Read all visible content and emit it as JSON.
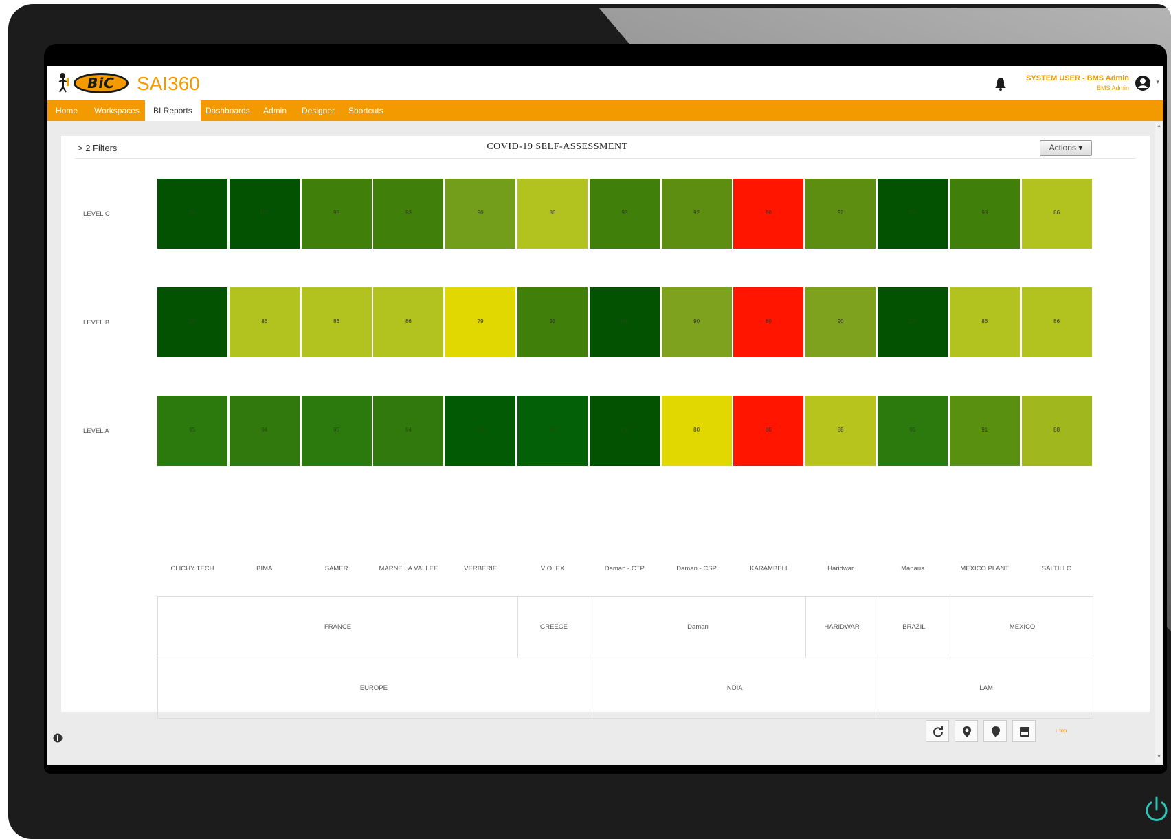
{
  "app": {
    "title": "SAI360",
    "logo_text": "BiC"
  },
  "user": {
    "name": "SYSTEM USER - BMS Admin",
    "role": "BMS Admin"
  },
  "nav": {
    "items": [
      {
        "label": "Home",
        "active": false
      },
      {
        "label": "Workspaces",
        "active": false
      },
      {
        "label": "BI Reports",
        "active": true
      },
      {
        "label": "Dashboards",
        "active": false
      },
      {
        "label": "Admin",
        "active": false
      },
      {
        "label": "Designer",
        "active": false
      },
      {
        "label": "Shortcuts",
        "active": false
      }
    ]
  },
  "report": {
    "filters_label": "> 2 Filters",
    "title": "COVID-19 SELF-ASSESSMENT",
    "actions_label": "Actions ▾"
  },
  "chart_data": {
    "type": "heatmap",
    "title": "COVID-19 SELF-ASSESSMENT",
    "rows": [
      "LEVEL C",
      "LEVEL B",
      "LEVEL A"
    ],
    "columns": [
      "CLICHY TECH",
      "BIMA",
      "SAMER",
      "MARNE LA VALLEE",
      "VERBERIE",
      "VIOLEX",
      "Daman - CTP",
      "Daman - CSP",
      "KARAMBELI",
      "Haridwar",
      "Manaus",
      "MEXICO PLANT",
      "SALTILLO"
    ],
    "values": [
      [
        100,
        100,
        93,
        93,
        90,
        86,
        93,
        92,
        80,
        92,
        100,
        93,
        86
      ],
      [
        100,
        86,
        86,
        86,
        79,
        93,
        100,
        90,
        80,
        90,
        100,
        86,
        86
      ],
      [
        95,
        94,
        95,
        94,
        100,
        98,
        100,
        80,
        80,
        88,
        95,
        91,
        88
      ]
    ],
    "colors": [
      [
        "#025202",
        "#025202",
        "#3f7f0a",
        "#3f7f0a",
        "#739e1b",
        "#b2c21e",
        "#3f7f0a",
        "#5d8e12",
        "#ff1500",
        "#5d8e12",
        "#025202",
        "#3f7f0a",
        "#b2c21e"
      ],
      [
        "#025202",
        "#b2c21e",
        "#b2c21e",
        "#b2c21e",
        "#e0d800",
        "#3f7f0a",
        "#025202",
        "#7ea21d",
        "#ff1500",
        "#7ea21d",
        "#025202",
        "#b2c21e",
        "#b2c21e"
      ],
      [
        "#2c7a0e",
        "#31790d",
        "#2c7a0e",
        "#31790d",
        "#035a04",
        "#046006",
        "#025202",
        "#e0d800",
        "#ff1500",
        "#b7c41e",
        "#2c7a0e",
        "#5a900f",
        "#a0b81e"
      ]
    ],
    "country_groups": [
      {
        "name": "FRANCE",
        "span": 5
      },
      {
        "name": "GREECE",
        "span": 1
      },
      {
        "name": "Daman",
        "span": 3
      },
      {
        "name": "HARIDWAR",
        "span": 1
      },
      {
        "name": "BRAZIL",
        "span": 1
      },
      {
        "name": "MEXICO",
        "span": 2
      }
    ],
    "region_groups": [
      {
        "name": "EUROPE",
        "span": 6
      },
      {
        "name": "INDIA",
        "span": 4
      },
      {
        "name": "LAM",
        "span": 3
      }
    ]
  },
  "footer": {
    "top_link": "↑ top",
    "tools": [
      "refresh-icon",
      "map-pin-outline-icon",
      "map-pin-filled-icon",
      "save-icon"
    ]
  },
  "colors": {
    "accent": "#f29a00",
    "bezel": "#1c1c1c",
    "power": "#2ec4b6"
  }
}
